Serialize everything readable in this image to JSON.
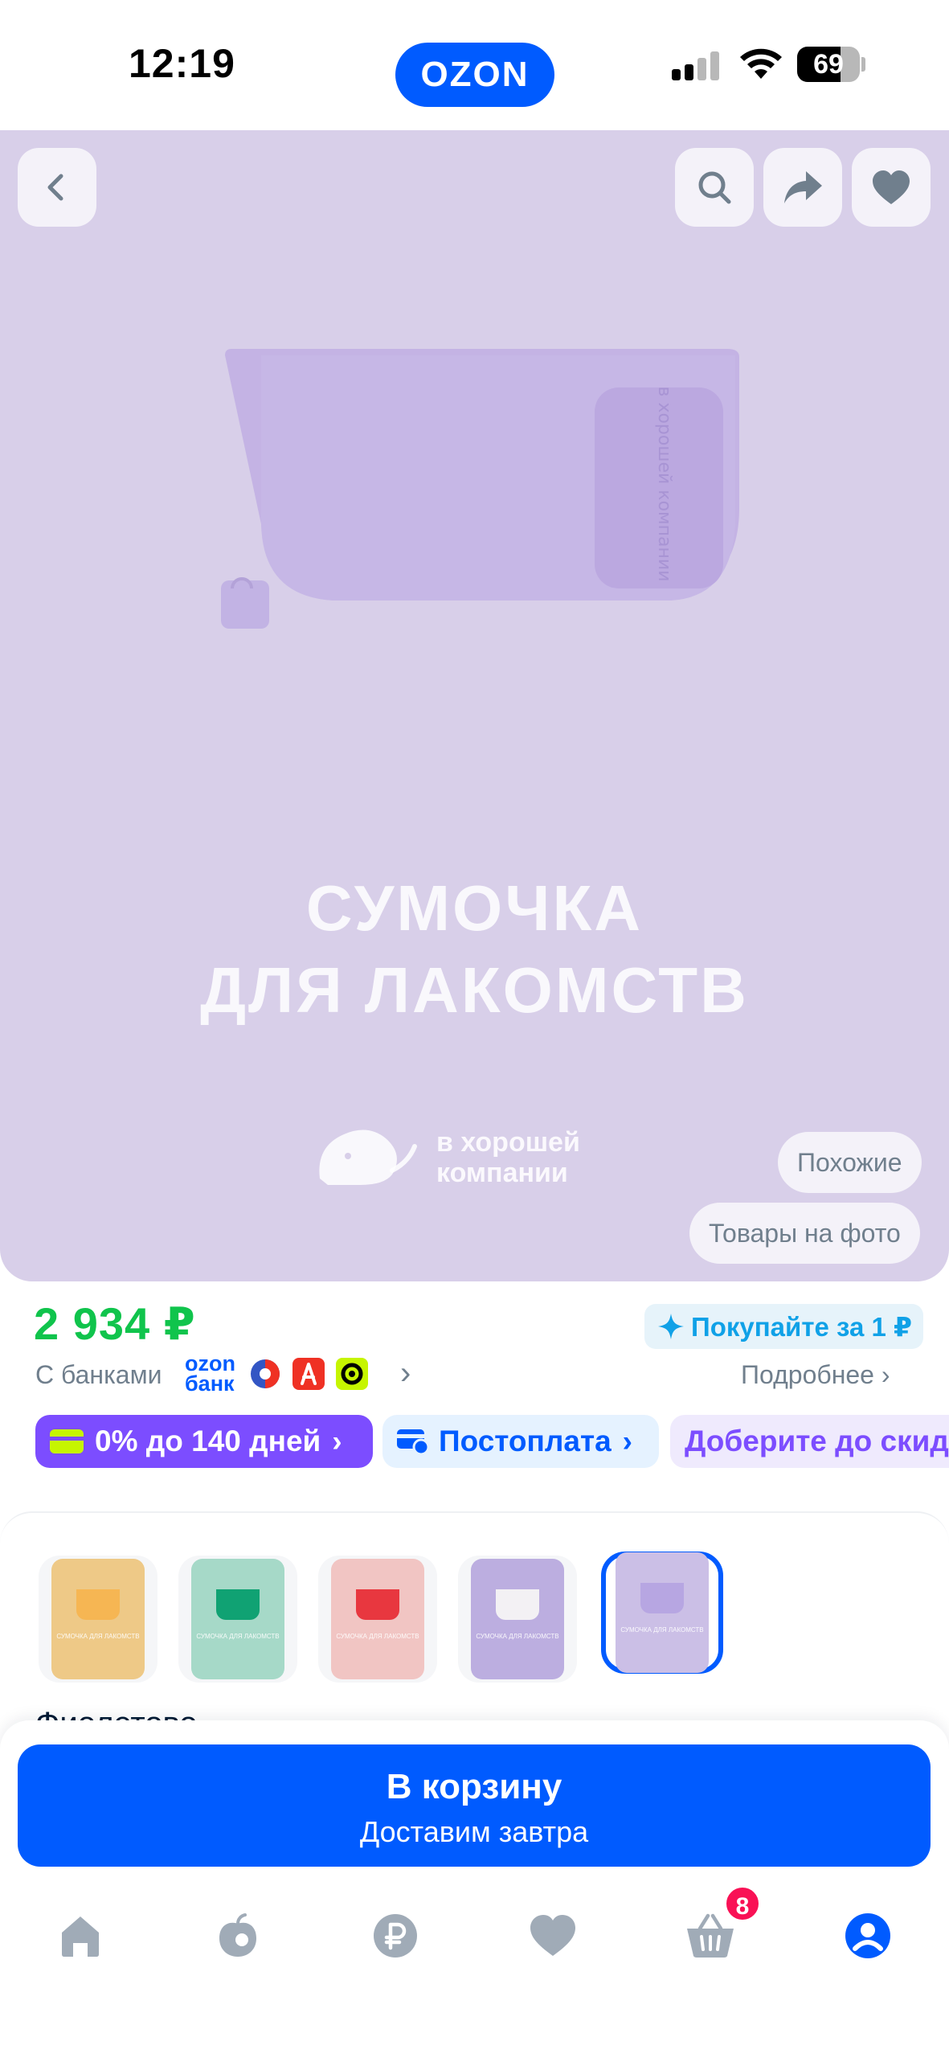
{
  "status_bar": {
    "time": "12:19",
    "battery": "69",
    "battery_level": 0.69
  },
  "app": {
    "logo": "OZON",
    "brand_color": "#005bff"
  },
  "gallery": {
    "background": "#d8cfe9",
    "promo_line1": "СУМОЧКА",
    "promo_line2": "ДЛЯ ЛАКОМСТВ",
    "brand_line1": "в хорошей",
    "brand_line2": "компании",
    "similar_chip": "Похожие",
    "photo_goods_chip": "Товары на фото",
    "icons": [
      "back-icon",
      "search-icon",
      "share-icon",
      "heart-icon"
    ]
  },
  "price_block": {
    "price": "2 934 ₽",
    "buy_for_one": "Покупайте за 1 ₽",
    "banks_label": "С банками",
    "ozon_bank": "ozon банк",
    "more_link": "Подробнее",
    "credit_pill": "0% до 140 дней",
    "postpay_pill": "Постоплата",
    "discount_pill": "Доберите до скидки"
  },
  "variants": {
    "swatch_text": "СУМОЧКА ДЛЯ ЛАКОМСТВ",
    "items": [
      {
        "card": "#eec987",
        "bag": "#f6b653"
      },
      {
        "card": "#a6d9c8",
        "bag": "#10a273"
      },
      {
        "card": "#f1c5c3",
        "bag": "#e8373f"
      },
      {
        "card": "#bcaee0",
        "bag": "#f3f1f4"
      },
      {
        "card": "#cbbfe6",
        "bag": "#b7a6e2"
      }
    ],
    "selected_index": 4,
    "color_name": "Фиолетово"
  },
  "cart": {
    "label": "В корзину",
    "delivery": "Доставим завтра"
  },
  "nav": {
    "items": [
      "home-icon",
      "catalog-icon",
      "ruble-icon",
      "favorites-icon",
      "cart-icon",
      "profile-icon"
    ],
    "cart_badge": "8"
  }
}
